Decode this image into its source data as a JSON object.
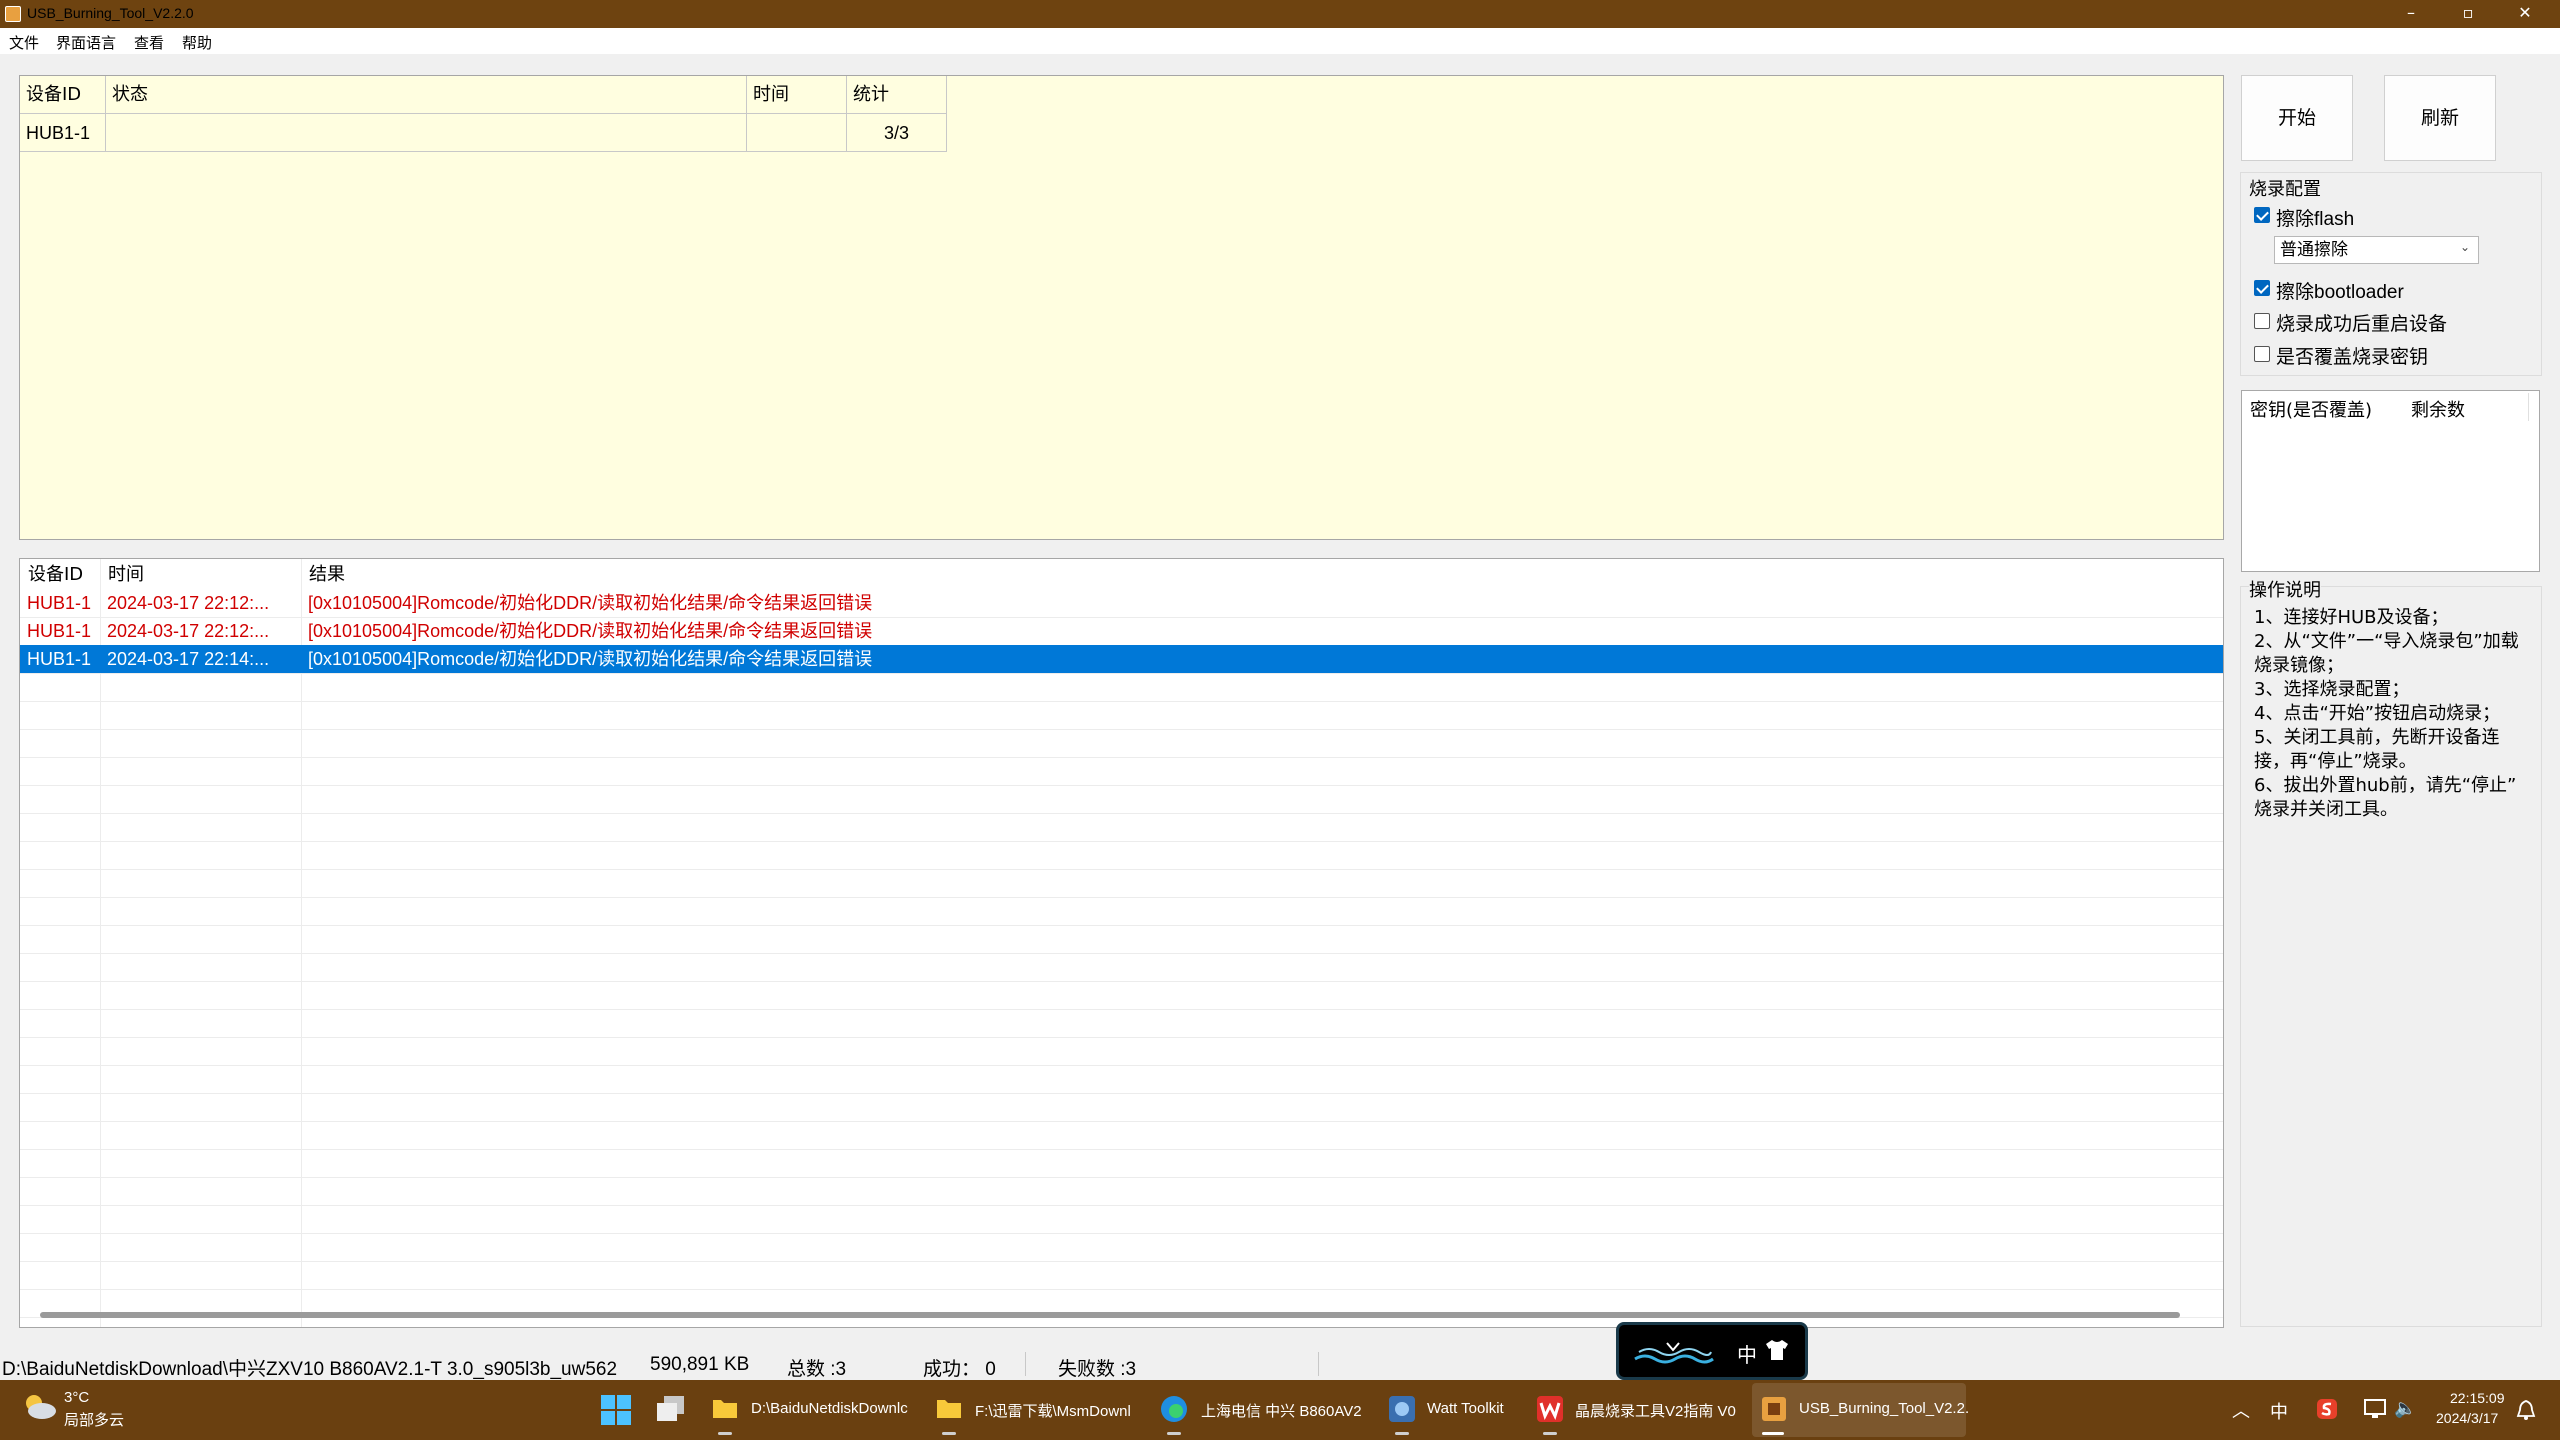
{
  "window": {
    "title": "USB_Burning_Tool_V2.2.0",
    "minimize": "–",
    "maximize": "▫",
    "close": "✕"
  },
  "menu": [
    "文件",
    "界面语言",
    "查看",
    "帮助"
  ],
  "device_table": {
    "headers": [
      "设备ID",
      "状态",
      "时间",
      "统计"
    ],
    "rows": [
      {
        "id": "HUB1-1",
        "status": "",
        "time": "",
        "stats": "3/3"
      }
    ]
  },
  "buttons": {
    "start": "开始",
    "refresh": "刷新"
  },
  "config": {
    "title": "烧录配置",
    "erase_flash": {
      "label": "擦除flash",
      "checked": true
    },
    "erase_mode": "普通擦除",
    "erase_bootloader": {
      "label": "擦除bootloader",
      "checked": true
    },
    "reboot_after": {
      "label": "烧录成功后重启设备",
      "checked": false
    },
    "overwrite_key": {
      "label": "是否覆盖烧录密钥",
      "checked": false
    }
  },
  "key_list": {
    "headers": [
      "密钥(是否覆盖)",
      "剩余数"
    ]
  },
  "instructions": {
    "title": "操作说明",
    "lines": [
      "1、连接好HUB及设备；",
      "2、从“文件”一“导入烧录包”加载",
      "烧录镜像；",
      "3、选择烧录配置；",
      "4、点击“开始”按钮启动烧录；",
      "5、关闭工具前，先断开设备连",
      "接，再“停止”烧录。",
      "6、拔出外置hub前，请先“停止”",
      "烧录并关闭工具。"
    ]
  },
  "log": {
    "headers": [
      "设备ID",
      "时间",
      "结果"
    ],
    "rows": [
      {
        "id": "HUB1-1",
        "time": "2024-03-17 22:12:...",
        "result": "[0x10105004]Romcode/初始化DDR/读取初始化结果/命令结果返回错误"
      },
      {
        "id": "HUB1-1",
        "time": "2024-03-17 22:12:...",
        "result": "[0x10105004]Romcode/初始化DDR/读取初始化结果/命令结果返回错误"
      },
      {
        "id": "HUB1-1",
        "time": "2024-03-17 22:14:...",
        "result": "[0x10105004]Romcode/初始化DDR/读取初始化结果/命令结果返回错误"
      }
    ],
    "selected_index": 2
  },
  "status": {
    "path": "D:\\BaiduNetdiskDownload\\中兴ZXV10 B860AV2.1-T 3.0_s905l3b_uw562",
    "size": "590,891 KB",
    "total": "总数 :3",
    "success": "成功：  0",
    "fail": "失败数 :3"
  },
  "float_widget": {
    "ime": "中"
  },
  "taskbar": {
    "weather_temp": "3°C",
    "weather_desc": "局部多云",
    "items": [
      "D:\\BaiduNetdiskDownlc",
      "F:\\迅雷下载\\MsmDownl",
      "上海电信 中兴 B860AV2",
      "Watt Toolkit",
      "晶晨烧录工具V2指南 V0",
      "USB_Burning_Tool_V2.2."
    ],
    "tray_ime": "中",
    "time": "22:15:09",
    "date": "2024/3/17"
  }
}
